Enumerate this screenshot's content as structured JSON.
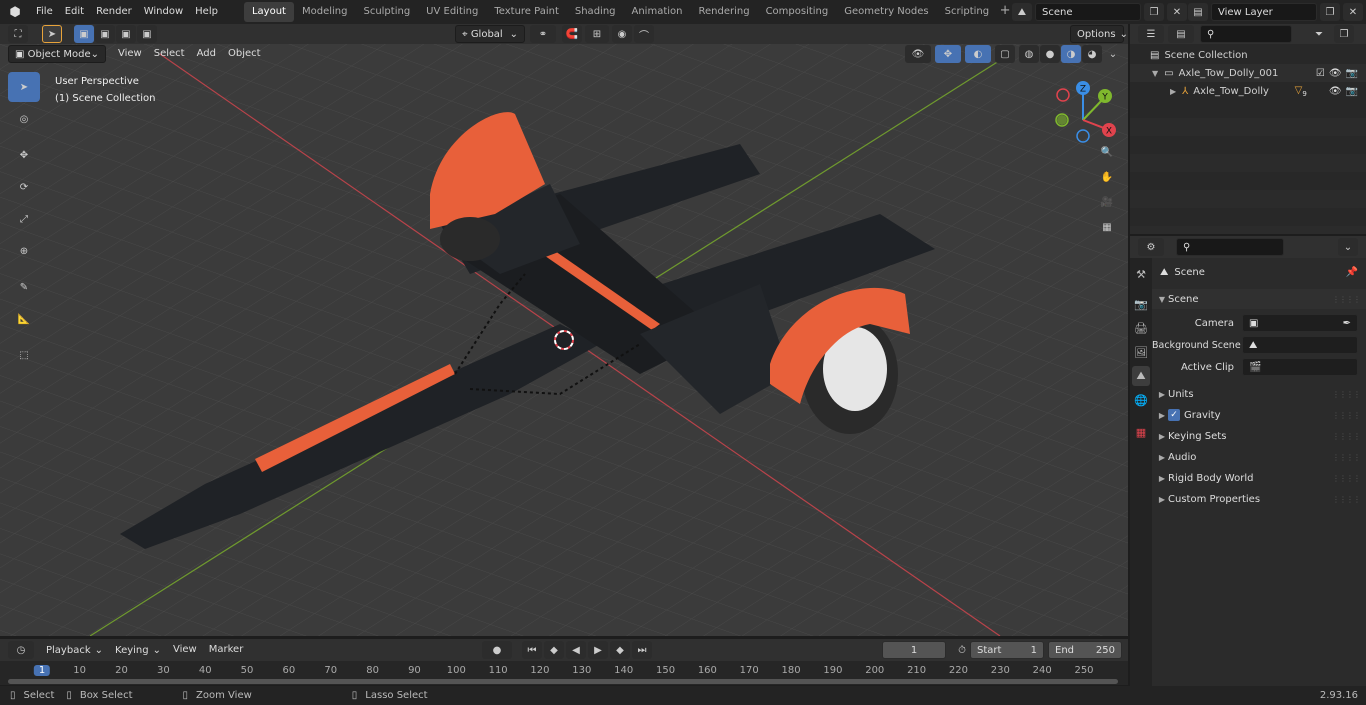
{
  "topbar": {
    "menus": [
      "File",
      "Edit",
      "Render",
      "Window",
      "Help"
    ],
    "workspaces": [
      "Layout",
      "Modeling",
      "Sculpting",
      "UV Editing",
      "Texture Paint",
      "Shading",
      "Animation",
      "Rendering",
      "Compositing",
      "Geometry Nodes",
      "Scripting"
    ],
    "active_workspace": "Layout",
    "scene": "Scene",
    "view_layer": "View Layer"
  },
  "viewport_header": {
    "mode": "Object Mode",
    "menus": [
      "View",
      "Select",
      "Add",
      "Object"
    ],
    "transform_orientation": "Global",
    "options": "Options"
  },
  "viewport": {
    "perspective": "User Perspective",
    "collection": "(1) Scene Collection",
    "axes": {
      "z": "Z",
      "y": "Y",
      "x": "X"
    }
  },
  "outliner": {
    "root": "Scene Collection",
    "items": [
      {
        "label": "Axle_Tow_Dolly_001"
      },
      {
        "label": "Axle_Tow_Dolly",
        "badge": "9"
      }
    ]
  },
  "properties": {
    "context": "Scene",
    "panel": "Scene",
    "fields": [
      {
        "label": "Camera",
        "value": ""
      },
      {
        "label": "Background Scene",
        "value": ""
      },
      {
        "label": "Active Clip",
        "value": ""
      }
    ],
    "subpanels": [
      "Units",
      "Gravity",
      "Keying Sets",
      "Audio",
      "Rigid Body World",
      "Custom Properties"
    ],
    "gravity_checked": true
  },
  "timeline": {
    "menus": [
      "Playback",
      "Keying",
      "View",
      "Marker"
    ],
    "current_frame": "1",
    "start_label": "Start",
    "start": "1",
    "end_label": "End",
    "end": "250",
    "ticks": [
      "1",
      "10",
      "20",
      "30",
      "40",
      "50",
      "60",
      "70",
      "80",
      "90",
      "100",
      "110",
      "120",
      "130",
      "140",
      "150",
      "160",
      "170",
      "180",
      "190",
      "200",
      "210",
      "220",
      "230",
      "240",
      "250"
    ]
  },
  "status": {
    "select": "Select",
    "box_select": "Box Select",
    "zoom_view": "Zoom View",
    "lasso_select": "Lasso Select",
    "version": "2.93.16"
  },
  "colors": {
    "accent": "#4772b3",
    "orange": "#e8603a",
    "x_axis": "#e0434d",
    "y_axis": "#7fb82d",
    "z_axis": "#3a8ee6"
  }
}
